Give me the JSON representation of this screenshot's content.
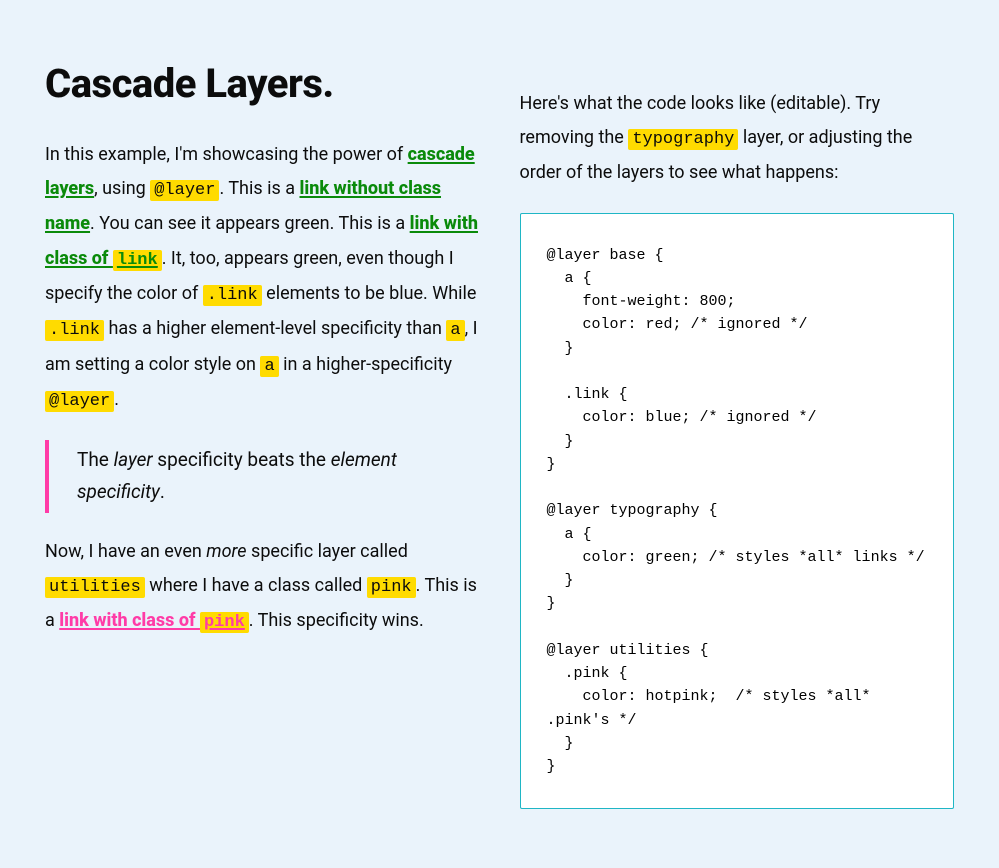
{
  "left": {
    "title": "Cascade Layers.",
    "p1": {
      "t1": "In this example, I'm showcasing the power of ",
      "link_cascade": "cascade layers",
      "t2": ", using ",
      "code_layer": "@layer",
      "t3": ". This is a ",
      "link_noclass": "link without class name",
      "t4": ". You can see it appears green. This is a ",
      "link_withclass_prefix": "link with class of ",
      "code_link": "link",
      "t5": ". It, too, appears green, even though I specify the color of ",
      "code_dotlink1": ".link",
      "t6": " elements to be blue. While ",
      "code_dotlink2": ".link",
      "t7": " has a higher element-level specificity than ",
      "code_a1": "a",
      "t8": ", I am setting a color style on ",
      "code_a2": "a",
      "t9": " in a higher-specificity ",
      "code_layer2": "@layer",
      "t10": "."
    },
    "quote": {
      "t1": "The ",
      "em1": "layer",
      "t2": " specificity beats the ",
      "em2": "element specificity",
      "t3": "."
    },
    "p2": {
      "t1": "Now, I have an even ",
      "em_more": "more",
      "t2": " specific layer called ",
      "code_utilities": "utilities",
      "t3": " where I have a class called ",
      "code_pink": "pink",
      "t4": ". This is a ",
      "link_pink_prefix": "link with class of ",
      "code_pink2": "pink",
      "t5": ". This specificity wins."
    }
  },
  "right": {
    "intro": {
      "t1": "Here's what the code looks like (editable). Try removing the ",
      "code_typography": "typography",
      "t2": " layer, or adjusting the order of the layers to see what happens:"
    },
    "code": "@layer base {\n  a {\n    font-weight: 800;\n    color: red; /* ignored */\n  }\n\n  .link {\n    color: blue; /* ignored */\n  }\n}\n\n@layer typography {\n  a {\n    color: green; /* styles *all* links */\n  }\n}\n\n@layer utilities {\n  .pink {\n    color: hotpink;  /* styles *all* .pink's */\n  }\n}"
  }
}
